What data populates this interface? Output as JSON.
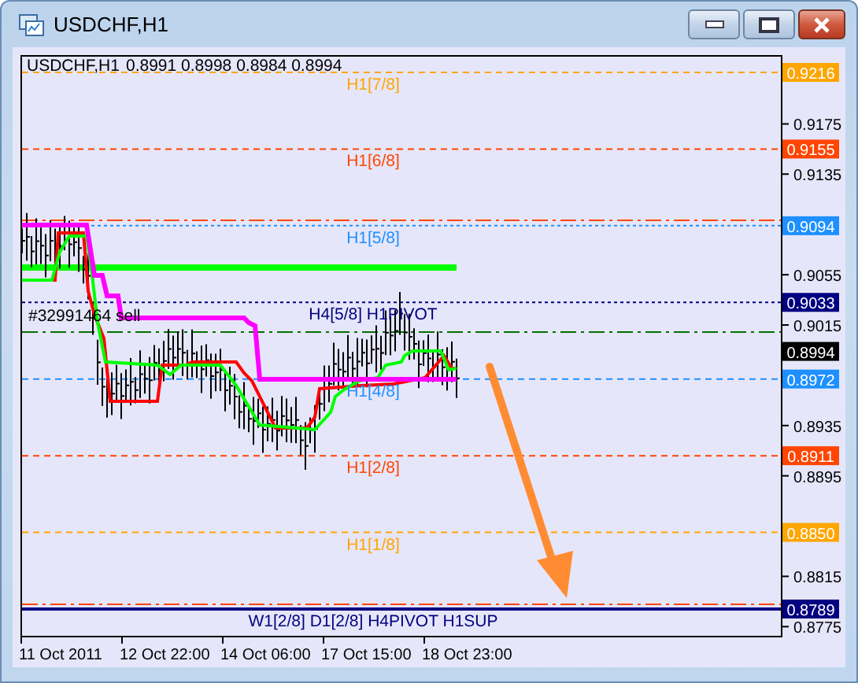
{
  "window": {
    "title": "USDCHF,H1"
  },
  "chart": {
    "symbol": "USDCHF,H1",
    "ohlc": "0.8991 0.8998 0.8984 0.8994",
    "levels": [
      {
        "price_tag": "0.9216",
        "label": "H1[7/8]",
        "color": "#ffa500",
        "kind": "dashed"
      },
      {
        "price_tag": "0.9155",
        "label": "H1[6/8]",
        "color": "#ff4500",
        "kind": "dashed"
      },
      {
        "price_tag": "0.9094",
        "label": "H1[5/8]",
        "color": "#1e90ff",
        "kind": "dotted"
      },
      {
        "price_tag": "0.9033",
        "label": "H4[5/8] H1PIVOT",
        "color": "#000080",
        "kind": "dotted"
      },
      {
        "price_tag": "0.8972",
        "label": "H1[4/8]",
        "color": "#1e90ff",
        "kind": "dashed"
      },
      {
        "price_tag": "0.8911",
        "label": "H1[2/8]",
        "color": "#ff4500",
        "kind": "dashed"
      },
      {
        "price_tag": "0.8850",
        "label": "H1[1/8]",
        "color": "#ffa500",
        "kind": "dashed"
      },
      {
        "price_tag": "0.8789",
        "label": "W1[2/8] D1[2/8] H4PIVOT H1SUP",
        "color": "#000080",
        "kind": "solid"
      }
    ],
    "current_price_tag": "0.8994",
    "order_label": "#32991464 sell",
    "price_ticks": [
      "0.9175",
      "0.9135",
      "0.9055",
      "0.9015",
      "0.8935",
      "0.8895",
      "0.8815",
      "0.8775"
    ],
    "time_ticks": [
      "11 Oct 2011",
      "12 Oct 22:00",
      "14 Oct 06:00",
      "17 Oct 15:00",
      "18 Oct 23:00"
    ]
  }
}
